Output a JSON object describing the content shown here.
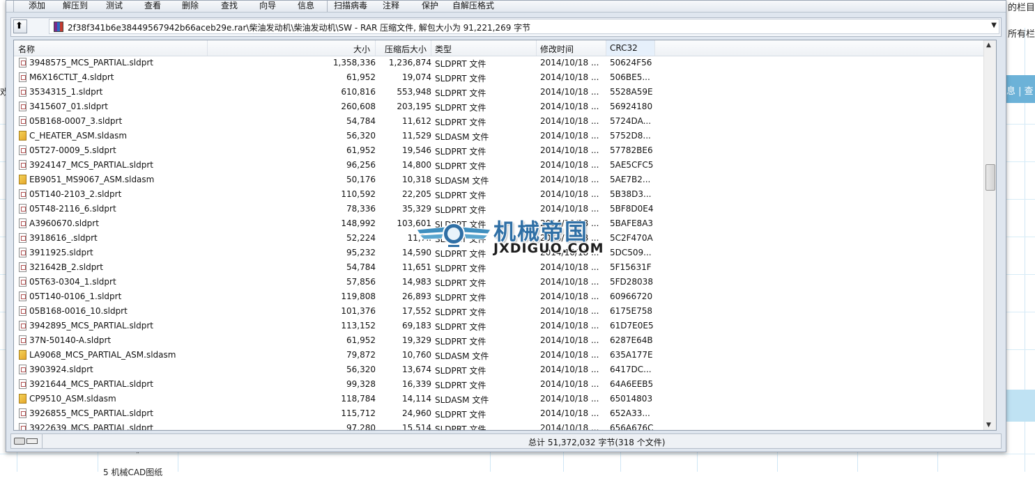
{
  "background": {
    "right_text_top": "的栏目",
    "right_text_second": "所有栏",
    "right_bar_text": "息 | 查",
    "left_char": "戏",
    "bottom_text": "5 机械CAD图纸"
  },
  "toolbar": {
    "items": [
      "添加",
      "解压到",
      "测试",
      "查看",
      "删除",
      "查找",
      "向导",
      "信息",
      "扫描病毒",
      "注释",
      "保护",
      "自解压格式"
    ]
  },
  "address": {
    "path": "2f38f341b6e38449567942b66aceb29e.rar\\柴油发动机\\柴油发动机\\SW - RAR 压缩文件, 解包大小为 91,221,269 字节"
  },
  "columns": {
    "name": "名称",
    "size": "大小",
    "packed": "压缩后大小",
    "type": "类型",
    "modified": "修改时间",
    "crc": "CRC32"
  },
  "files": [
    {
      "name": "3948575_MCS_PARTIAL.sldprt",
      "size": "1,358,336",
      "packed": "1,236,874",
      "type": "SLDPRT 文件",
      "modified": "2014/10/18 ...",
      "crc": "50624F56",
      "kind": "part"
    },
    {
      "name": "M6X16CTLT_4.sldprt",
      "size": "61,952",
      "packed": "19,074",
      "type": "SLDPRT 文件",
      "modified": "2014/10/18 ...",
      "crc": "506BE5...",
      "kind": "part"
    },
    {
      "name": "3534315_1.sldprt",
      "size": "610,816",
      "packed": "553,948",
      "type": "SLDPRT 文件",
      "modified": "2014/10/18 ...",
      "crc": "5528A59E",
      "kind": "part"
    },
    {
      "name": "3415607_01.sldprt",
      "size": "260,608",
      "packed": "203,195",
      "type": "SLDPRT 文件",
      "modified": "2014/10/18 ...",
      "crc": "56924180",
      "kind": "part"
    },
    {
      "name": "05B168-0007_3.sldprt",
      "size": "54,784",
      "packed": "11,612",
      "type": "SLDPRT 文件",
      "modified": "2014/10/18 ...",
      "crc": "5724DA...",
      "kind": "part"
    },
    {
      "name": "C_HEATER_ASM.sldasm",
      "size": "56,320",
      "packed": "11,529",
      "type": "SLDASM 文件",
      "modified": "2014/10/18 ...",
      "crc": "5752D8...",
      "kind": "asm"
    },
    {
      "name": "05T27-0009_5.sldprt",
      "size": "61,952",
      "packed": "19,546",
      "type": "SLDPRT 文件",
      "modified": "2014/10/18 ...",
      "crc": "57782BE6",
      "kind": "part"
    },
    {
      "name": "3924147_MCS_PARTIAL.sldprt",
      "size": "96,256",
      "packed": "14,800",
      "type": "SLDPRT 文件",
      "modified": "2014/10/18 ...",
      "crc": "5AE5CFC5",
      "kind": "part"
    },
    {
      "name": "EB9051_MS9067_ASM.sldasm",
      "size": "50,176",
      "packed": "10,318",
      "type": "SLDASM 文件",
      "modified": "2014/10/18 ...",
      "crc": "5AE7B2...",
      "kind": "asm"
    },
    {
      "name": "05T140-2103_2.sldprt",
      "size": "110,592",
      "packed": "22,205",
      "type": "SLDPRT 文件",
      "modified": "2014/10/18 ...",
      "crc": "5B38D3...",
      "kind": "part"
    },
    {
      "name": "05T48-2116_6.sldprt",
      "size": "78,336",
      "packed": "35,329",
      "type": "SLDPRT 文件",
      "modified": "2014/10/18 ...",
      "crc": "5BF8D0E4",
      "kind": "part"
    },
    {
      "name": "A3960670.sldprt",
      "size": "148,992",
      "packed": "103,601",
      "type": "SLDPRT 文件",
      "modified": "2014/10/18 ...",
      "crc": "5BAFE8A3",
      "kind": "part"
    },
    {
      "name": "3918616_.sldprt",
      "size": "52,224",
      "packed": "11,7..",
      "type": "SLDPRT 文件",
      "modified": "2014/10/18 ...",
      "crc": "5C2F470A",
      "kind": "part"
    },
    {
      "name": "3911925.sldprt",
      "size": "95,232",
      "packed": "14,590",
      "type": "SLDPRT 文件",
      "modified": "2014/10/18 ...",
      "crc": "5DC509...",
      "kind": "part"
    },
    {
      "name": "321642B_2.sldprt",
      "size": "54,784",
      "packed": "11,651",
      "type": "SLDPRT 文件",
      "modified": "2014/10/18 ...",
      "crc": "5F15631F",
      "kind": "part"
    },
    {
      "name": "05T63-0304_1.sldprt",
      "size": "57,856",
      "packed": "14,983",
      "type": "SLDPRT 文件",
      "modified": "2014/10/18 ...",
      "crc": "5FD28038",
      "kind": "part"
    },
    {
      "name": "05T140-0106_1.sldprt",
      "size": "119,808",
      "packed": "26,893",
      "type": "SLDPRT 文件",
      "modified": "2014/10/18 ...",
      "crc": "60966720",
      "kind": "part"
    },
    {
      "name": "05B168-0016_10.sldprt",
      "size": "101,376",
      "packed": "17,552",
      "type": "SLDPRT 文件",
      "modified": "2014/10/18 ...",
      "crc": "6175E758",
      "kind": "part"
    },
    {
      "name": "3942895_MCS_PARTIAL.sldprt",
      "size": "113,152",
      "packed": "69,183",
      "type": "SLDPRT 文件",
      "modified": "2014/10/18 ...",
      "crc": "61D7E0E5",
      "kind": "part"
    },
    {
      "name": "37N-50140-A.sldprt",
      "size": "61,952",
      "packed": "19,329",
      "type": "SLDPRT 文件",
      "modified": "2014/10/18 ...",
      "crc": "6287E64B",
      "kind": "part"
    },
    {
      "name": "LA9068_MCS_PARTIAL_ASM.sldasm",
      "size": "79,872",
      "packed": "10,760",
      "type": "SLDASM 文件",
      "modified": "2014/10/18 ...",
      "crc": "635A177E",
      "kind": "asm"
    },
    {
      "name": "3903924.sldprt",
      "size": "56,320",
      "packed": "13,674",
      "type": "SLDPRT 文件",
      "modified": "2014/10/18 ...",
      "crc": "6417DC...",
      "kind": "part"
    },
    {
      "name": "3921644_MCS_PARTIAL.sldprt",
      "size": "99,328",
      "packed": "16,339",
      "type": "SLDPRT 文件",
      "modified": "2014/10/18 ...",
      "crc": "64A6EEB5",
      "kind": "part"
    },
    {
      "name": "CP9510_ASM.sldasm",
      "size": "118,784",
      "packed": "14,114",
      "type": "SLDASM 文件",
      "modified": "2014/10/18 ...",
      "crc": "65014803",
      "kind": "asm"
    },
    {
      "name": "3926855_MCS_PARTIAL.sldprt",
      "size": "115,712",
      "packed": "24,960",
      "type": "SLDPRT 文件",
      "modified": "2014/10/18 ...",
      "crc": "652A33...",
      "kind": "part"
    },
    {
      "name": "3922639_MCS_PARTIAL.sldprt",
      "size": "97,280",
      "packed": "15,514",
      "type": "SLDPRT 文件",
      "modified": "2014/10/18 ...",
      "crc": "656A676C",
      "kind": "part"
    }
  ],
  "status": {
    "summary": "总计 51,372,032 字节(318 个文件)"
  },
  "watermark": {
    "title": "机械帝国",
    "url": "JXDIGUO.COM",
    "logo_icon": "jx-wings-logo-icon"
  },
  "colors": {
    "window_bg": "#dfe6ef",
    "watermark_blue": "#2f6fa5"
  }
}
